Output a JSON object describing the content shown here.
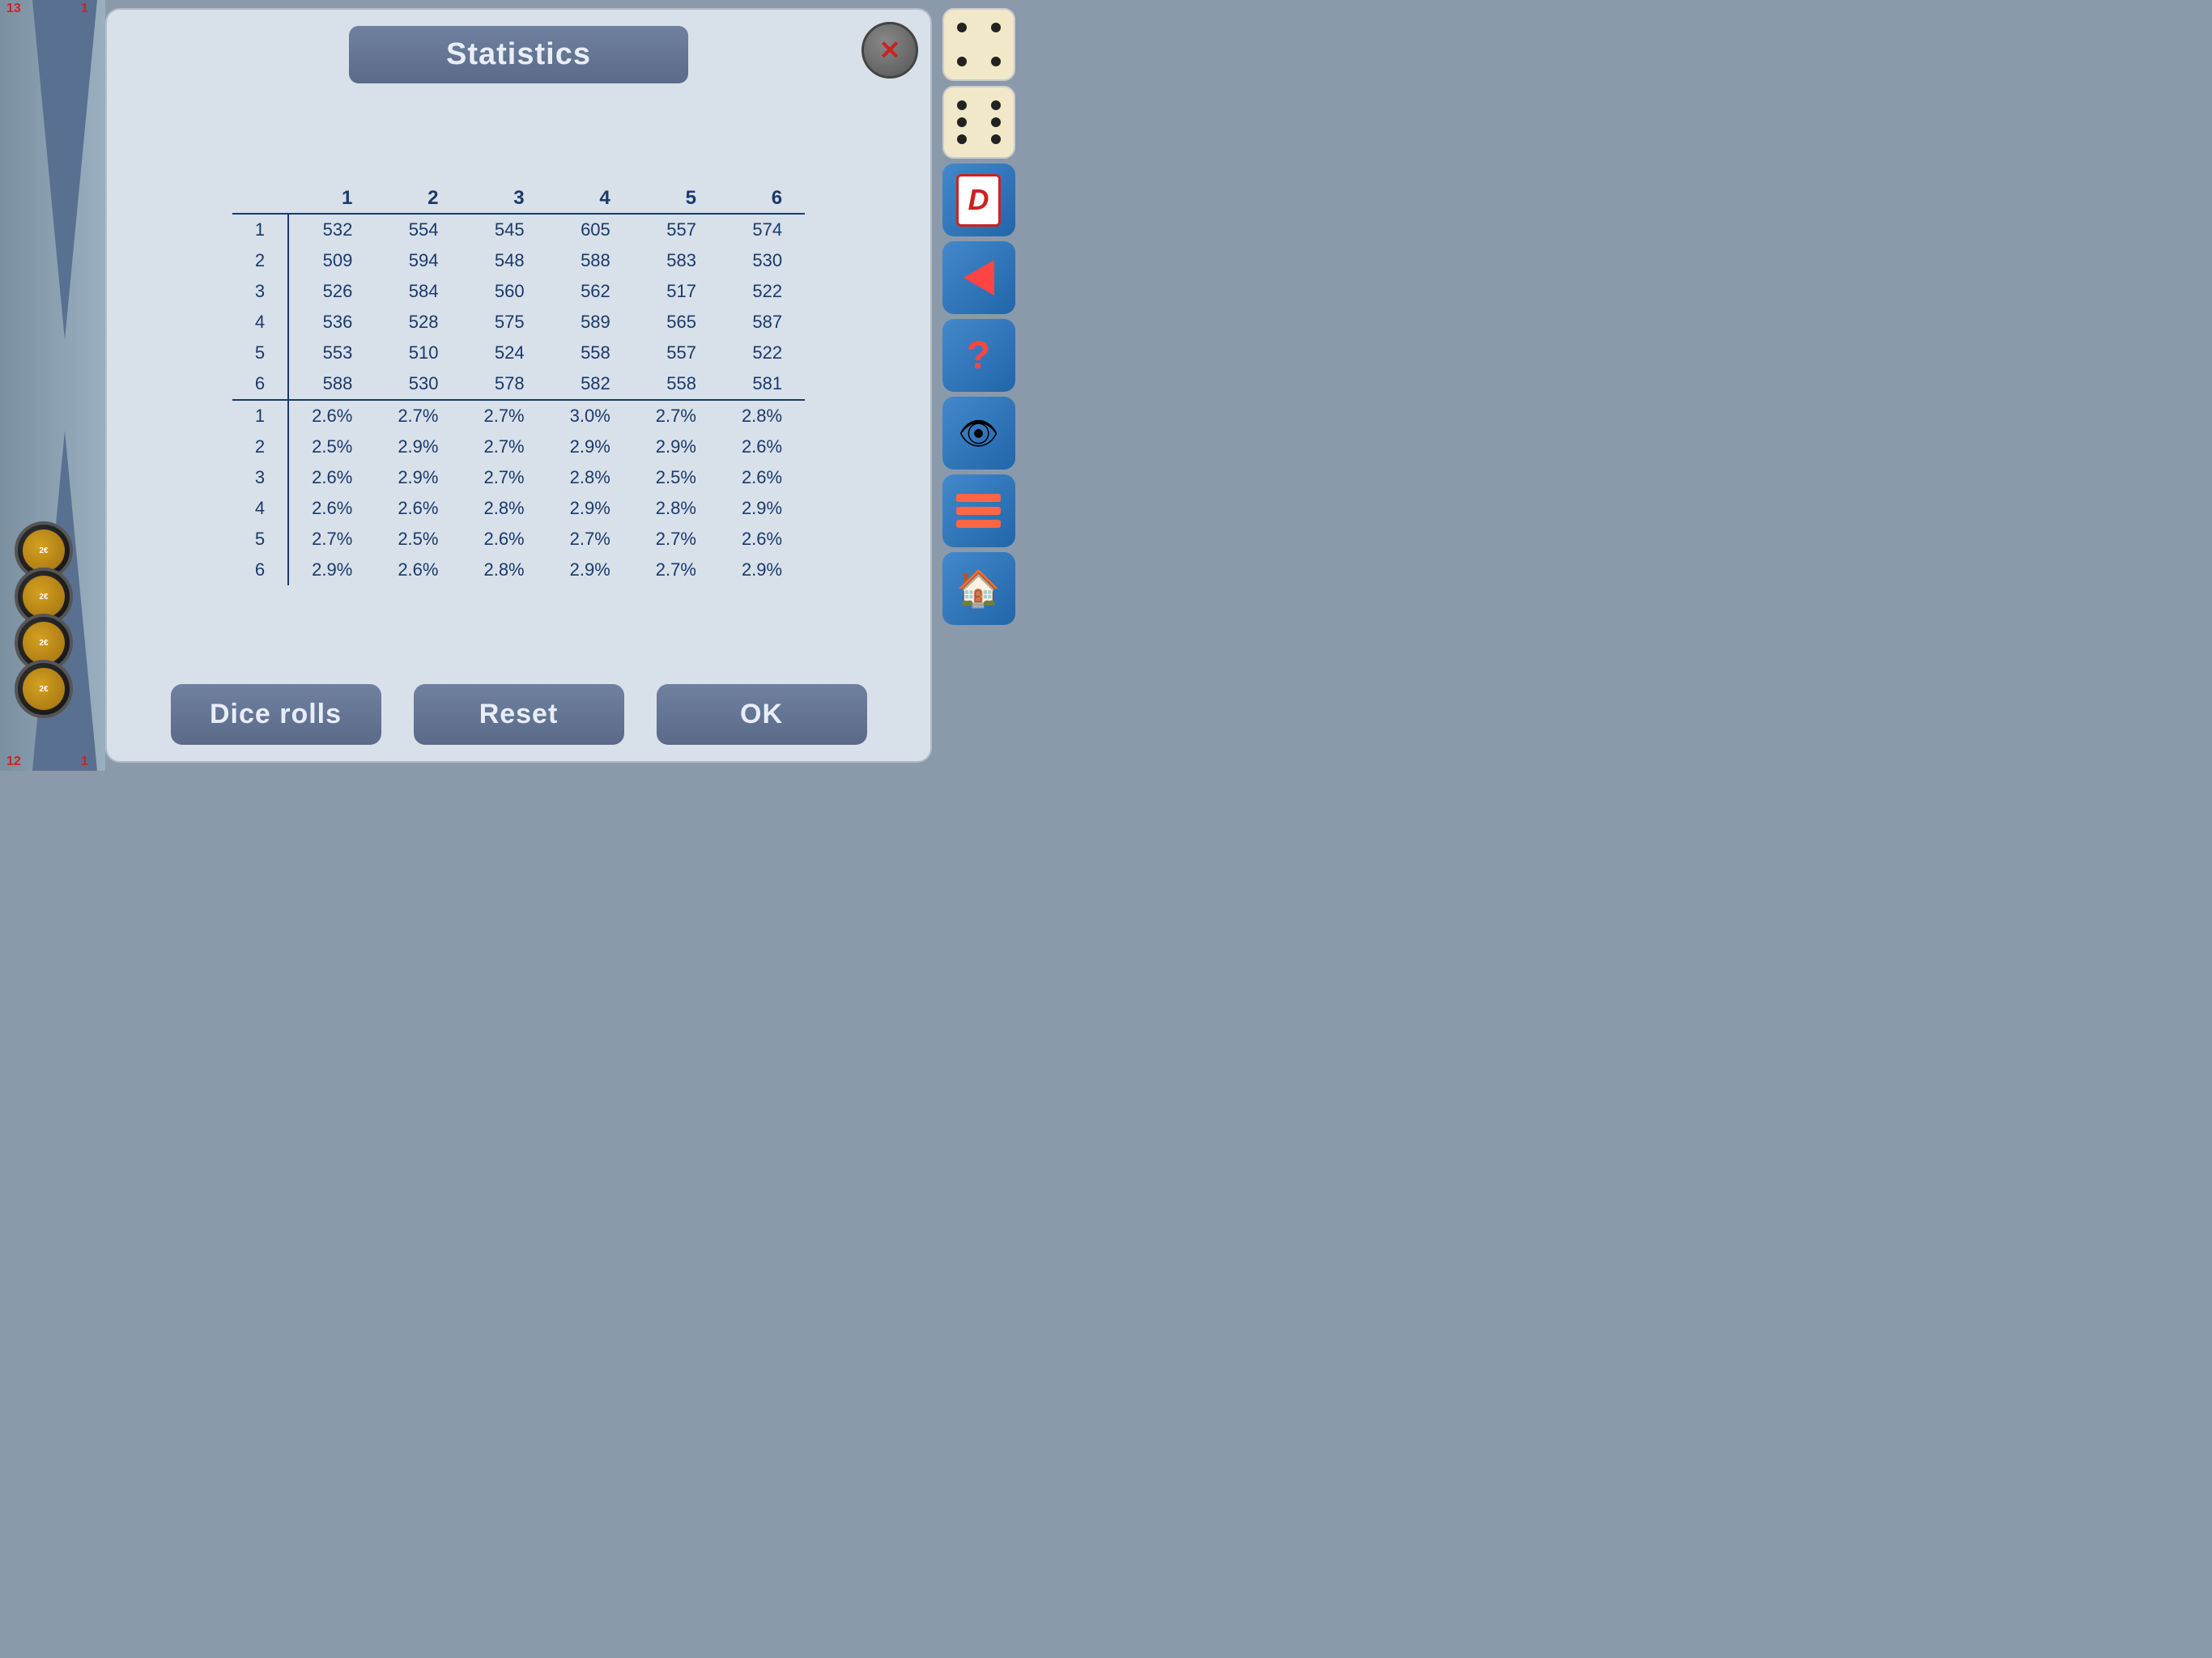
{
  "board": {
    "num_top_left": "13",
    "num_top_right": "1",
    "num_bottom_left": "12",
    "num_bottom_right": "1"
  },
  "dialog": {
    "title": "Statistics",
    "close_label": "✕",
    "table": {
      "col_headers": [
        "",
        "1",
        "2",
        "3",
        "4",
        "5",
        "6"
      ],
      "counts": [
        [
          "1",
          "532",
          "554",
          "545",
          "605",
          "557",
          "574"
        ],
        [
          "2",
          "509",
          "594",
          "548",
          "588",
          "583",
          "530"
        ],
        [
          "3",
          "526",
          "584",
          "560",
          "562",
          "517",
          "522"
        ],
        [
          "4",
          "536",
          "528",
          "575",
          "589",
          "565",
          "587"
        ],
        [
          "5",
          "553",
          "510",
          "524",
          "558",
          "557",
          "522"
        ],
        [
          "6",
          "588",
          "530",
          "578",
          "582",
          "558",
          "581"
        ]
      ],
      "percents": [
        [
          "1",
          "2.6%",
          "2.7%",
          "2.7%",
          "3.0%",
          "2.7%",
          "2.8%"
        ],
        [
          "2",
          "2.5%",
          "2.9%",
          "2.7%",
          "2.9%",
          "2.9%",
          "2.6%"
        ],
        [
          "3",
          "2.6%",
          "2.9%",
          "2.7%",
          "2.8%",
          "2.5%",
          "2.6%"
        ],
        [
          "4",
          "2.6%",
          "2.6%",
          "2.8%",
          "2.9%",
          "2.8%",
          "2.9%"
        ],
        [
          "5",
          "2.7%",
          "2.5%",
          "2.6%",
          "2.7%",
          "2.7%",
          "2.6%"
        ],
        [
          "6",
          "2.9%",
          "2.6%",
          "2.8%",
          "2.9%",
          "2.7%",
          "2.9%"
        ]
      ]
    },
    "buttons": {
      "dice_rolls": "Dice rolls",
      "reset": "Reset",
      "ok": "OK"
    }
  },
  "sidebar": {
    "dice4_label": "dice-4",
    "dice6_label": "dice-6",
    "d_label": "D",
    "play_label": "play",
    "help_label": "?",
    "eye_label": "👁",
    "menu_label": "menu",
    "home_label": "home"
  }
}
